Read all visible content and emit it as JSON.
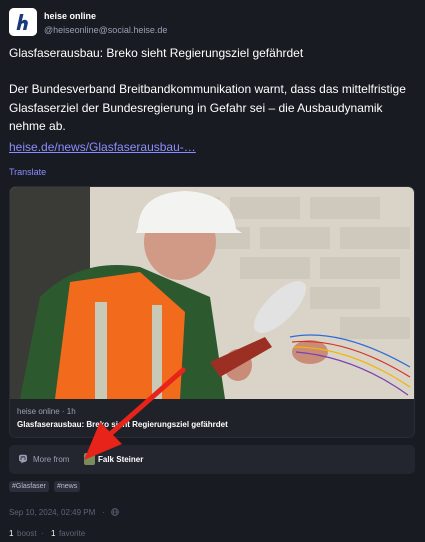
{
  "colors": {
    "background": "#191b22",
    "link": "#8c8dff",
    "muted": "#9aa0b4",
    "arrow": "#e8231a"
  },
  "account": {
    "avatar_icon": "heise-logo-icon",
    "display_name": "heise online",
    "handle": "@heiseonline@social.heise.de"
  },
  "post": {
    "title": "Glasfaserausbau: Breko sieht Regierungsziel gefährdet",
    "body": "Der Bundesverband Breitbandkommunikation warnt, dass das mittelfristige Glasfaserziel der Bundesregierung in Gefahr sei – die Ausbaudynamik nehme ab.",
    "link_text": "heise.de/news/Glasfaserausbau-…",
    "translate_label": "Translate"
  },
  "card": {
    "image_icon": "worker-fiber-photo",
    "meta": "heise online · 1h",
    "title": "Glasfaserausbau: Breko sieht Regierungsziel gefährdet"
  },
  "more_from": {
    "icon": "mastodon-icon",
    "label": "More from",
    "author_name": "Falk Steiner"
  },
  "tags": [
    "#Glasfaser",
    "#news"
  ],
  "meta": {
    "timestamp": "Sep 10, 2024, 02:49 PM",
    "separator": "·",
    "visibility_icon": "globe-icon"
  },
  "stats": {
    "boost_count": "1",
    "boost_label": "boost",
    "separator": "·",
    "favorite_count": "1",
    "favorite_label": "favorite"
  }
}
